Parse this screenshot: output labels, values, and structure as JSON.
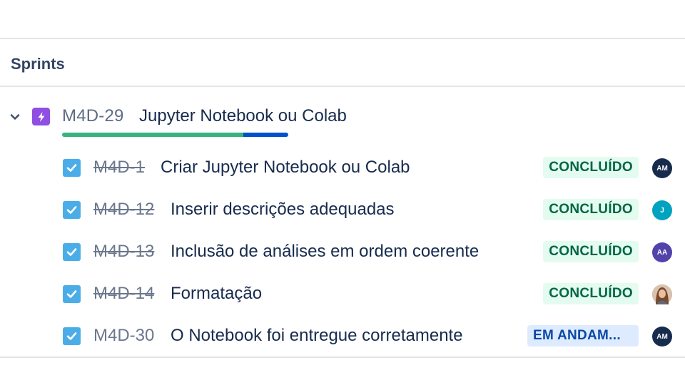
{
  "section": {
    "title": "Sprints"
  },
  "epic": {
    "key": "M4D-29",
    "title": "Jupyter Notebook ou Colab",
    "icon": "lightning-icon",
    "progress": {
      "done_fraction": 0.8,
      "in_progress_fraction": 0.2
    }
  },
  "issues": [
    {
      "key": "M4D-1",
      "title": "Criar Jupyter Notebook ou Colab",
      "status": "CONCLUÍDO",
      "done": true,
      "avatar": {
        "initials": "AM",
        "color": "#172b4d"
      }
    },
    {
      "key": "M4D-12",
      "title": "Inserir descrições adequadas",
      "status": "CONCLUÍDO",
      "done": true,
      "avatar": {
        "initials": "J",
        "color": "#00a3bf"
      }
    },
    {
      "key": "M4D-13",
      "title": "Inclusão de análises em ordem coerente",
      "status": "CONCLUÍDO",
      "done": true,
      "avatar": {
        "initials": "AA",
        "color": "#5243aa"
      }
    },
    {
      "key": "M4D-14",
      "title": "Formatação",
      "status": "CONCLUÍDO",
      "done": true,
      "avatar": {
        "initials": "",
        "color": "#a0765a",
        "photo": true
      }
    },
    {
      "key": "M4D-30",
      "title": "O Notebook foi entregue corretamente",
      "status": "EM ANDAM...",
      "done": false,
      "avatar": {
        "initials": "AM",
        "color": "#172b4d"
      }
    }
  ]
}
